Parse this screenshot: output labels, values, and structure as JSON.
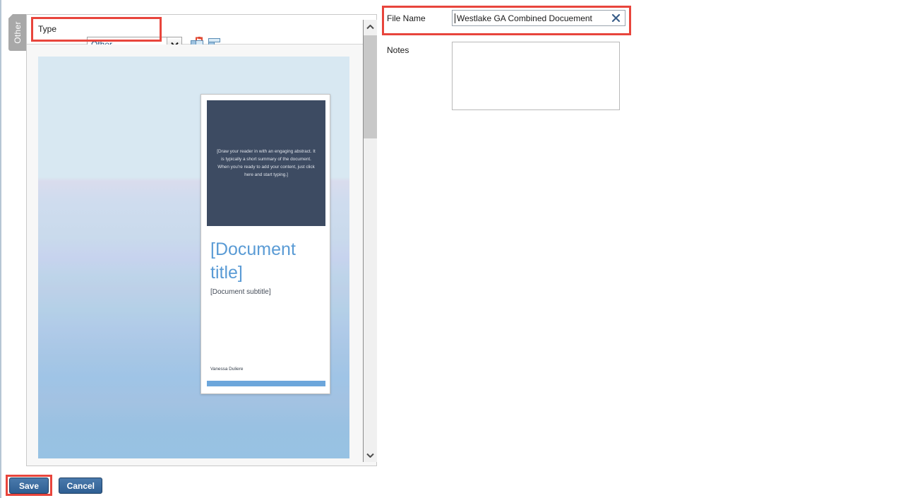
{
  "tab": {
    "label": "Other"
  },
  "toolbar": {
    "type_label": "Type",
    "type_value": "Other",
    "type_options": [
      "Other"
    ],
    "rotate_left_icon": "rotate-left-icon",
    "rotate_right_icon": "rotate-right-icon"
  },
  "preview": {
    "document": {
      "abstract": "[Draw your reader in with an engaging abstract. It is typically a short summary of the document. When you're ready to add your content, just click here and start typing.]",
      "title": "[Document title]",
      "subtitle": "[Document subtitle]",
      "author": "Vanessa Duliere"
    },
    "scrollbar": {
      "up_icon": "chevron-up-icon",
      "down_icon": "chevron-down-icon"
    }
  },
  "form": {
    "file_name_label": "File Name",
    "file_name_value": "Westlake GA Combined Docuement",
    "file_name_clear_icon": "close-icon",
    "notes_label": "Notes",
    "notes_value": ""
  },
  "footer": {
    "save_label": "Save",
    "cancel_label": "Cancel"
  },
  "colors": {
    "annotation_red": "#e8453c",
    "button_blue": "#2f5f93",
    "doc_title_blue": "#5a9bd5",
    "doc_header_navy": "#3d4b62",
    "tab_gray": "#a8a8a8"
  }
}
